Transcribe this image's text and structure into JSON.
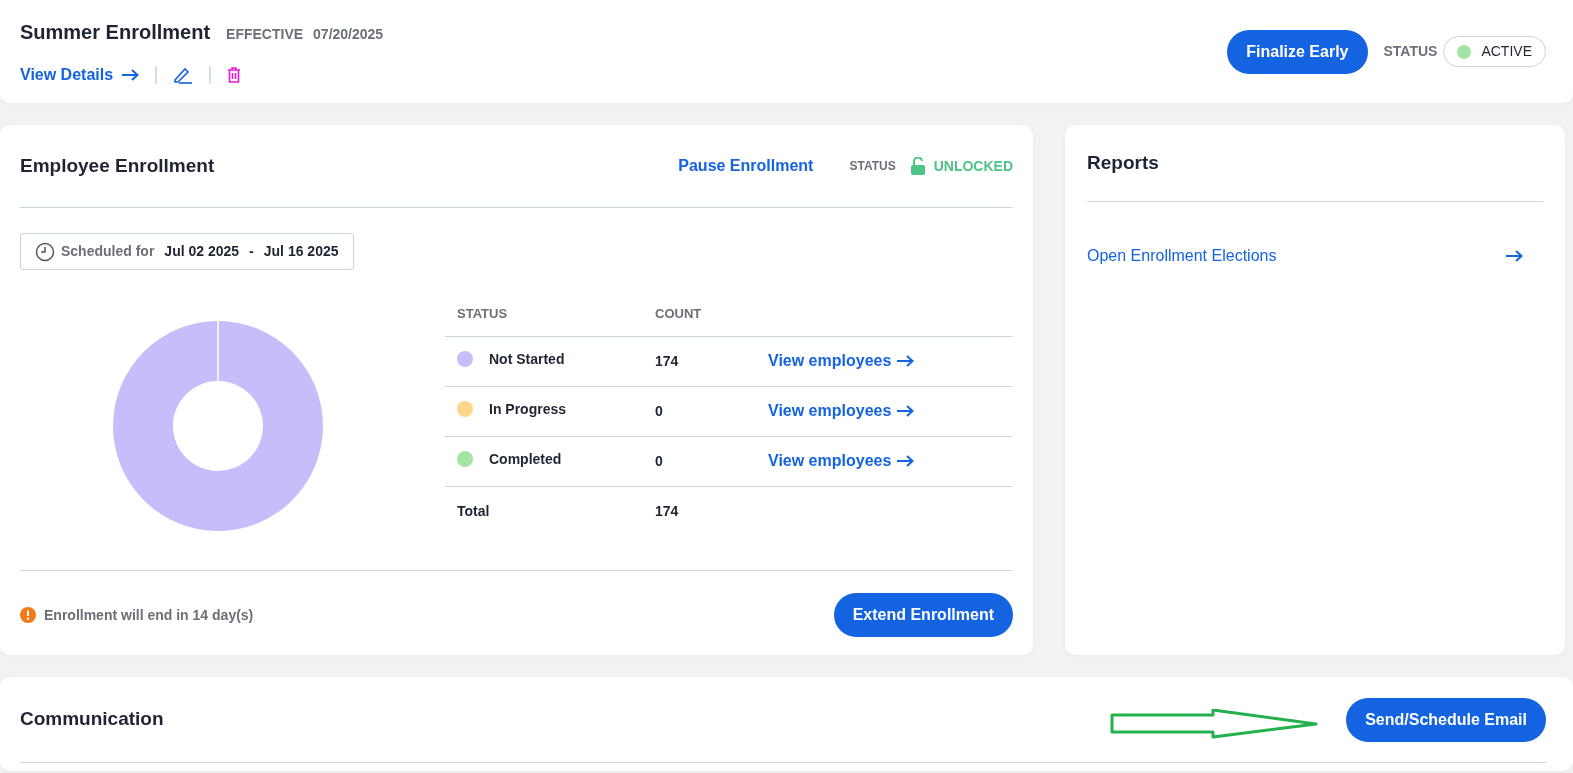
{
  "header": {
    "title": "Summer Enrollment",
    "effective_label": "EFFECTIVE",
    "effective_date": "07/20/2025",
    "view_details": "View Details",
    "finalize_button": "Finalize Early",
    "status_label": "STATUS",
    "status": "ACTIVE"
  },
  "enrollment": {
    "title": "Employee Enrollment",
    "pause_link": "Pause Enrollment",
    "status_label": "STATUS",
    "lock_status": "UNLOCKED",
    "schedule_label": "Scheduled for",
    "schedule_start": "Jul 02 2025",
    "schedule_sep": "-",
    "schedule_end": "Jul 16 2025",
    "table": {
      "columns": [
        "STATUS",
        "COUNT"
      ],
      "rows": [
        {
          "status": "Not Started",
          "color": "#c8bdfb",
          "count": "174",
          "link": "View employees"
        },
        {
          "status": "In Progress",
          "color": "#fdd58a",
          "count": "0",
          "link": "View employees"
        },
        {
          "status": "Completed",
          "color": "#a3e4a5",
          "count": "0",
          "link": "View employees"
        }
      ],
      "total": {
        "label": "Total",
        "count": "174"
      }
    },
    "notice": "Enrollment will end in **14 day(s)**",
    "extend_button": "Extend Enrollment"
  },
  "reports": {
    "title": "Reports",
    "items": [
      "Open Enrollment Elections"
    ]
  },
  "communication": {
    "title": "Communication",
    "send_button": "Send/Schedule Email"
  }
}
